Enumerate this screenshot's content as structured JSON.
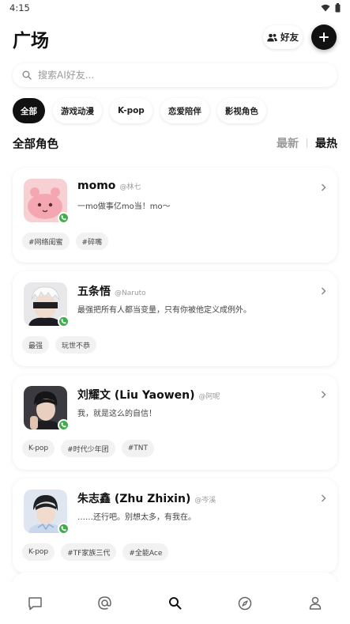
{
  "status_bar": {
    "time": "4:15",
    "icons": [
      "wifi-icon",
      "battery-icon"
    ]
  },
  "header": {
    "title": "广场",
    "friends_label": "好友",
    "add_icon": "plus-icon"
  },
  "search": {
    "placeholder": "搜索AI好友..."
  },
  "categories": [
    {
      "label": "全部",
      "active": true
    },
    {
      "label": "游戏动漫",
      "active": false
    },
    {
      "label": "K-pop",
      "active": false
    },
    {
      "label": "恋爱陪伴",
      "active": false
    },
    {
      "label": "影视角色",
      "active": false
    }
  ],
  "section": {
    "title": "全部角色",
    "sort_latest": "最新",
    "sort_hot": "最热"
  },
  "characters": [
    {
      "name": "momo",
      "handle": "@林七",
      "description": "一mo做事亿mo当！mo～",
      "tags": [
        "#网络闺蜜",
        "#碎嘴"
      ]
    },
    {
      "name": "五条悟",
      "handle": "@Naruto",
      "description": "最强把所有人都当变量，只有你被他定义成例外。",
      "tags": [
        "最强",
        "玩世不恭"
      ]
    },
    {
      "name": "刘耀文 (Liu Yaowen)",
      "handle": "@阿呢",
      "description": "我，就是这么的自信！",
      "tags": [
        "K-pop",
        "#时代少年团",
        "#TNT"
      ]
    },
    {
      "name": "朱志鑫 (Zhu Zhixin)",
      "handle": "@岑溪",
      "description": "……还行吧。别想太多，有我在。",
      "tags": [
        "K-pop",
        "#TF家族三代",
        "#全能Ace"
      ]
    }
  ],
  "bottom_nav": [
    "chat-icon",
    "at-icon",
    "search-icon",
    "compass-icon",
    "profile-icon"
  ],
  "colors": {
    "accent": "#111111",
    "call_badge": "#3fae4a"
  }
}
